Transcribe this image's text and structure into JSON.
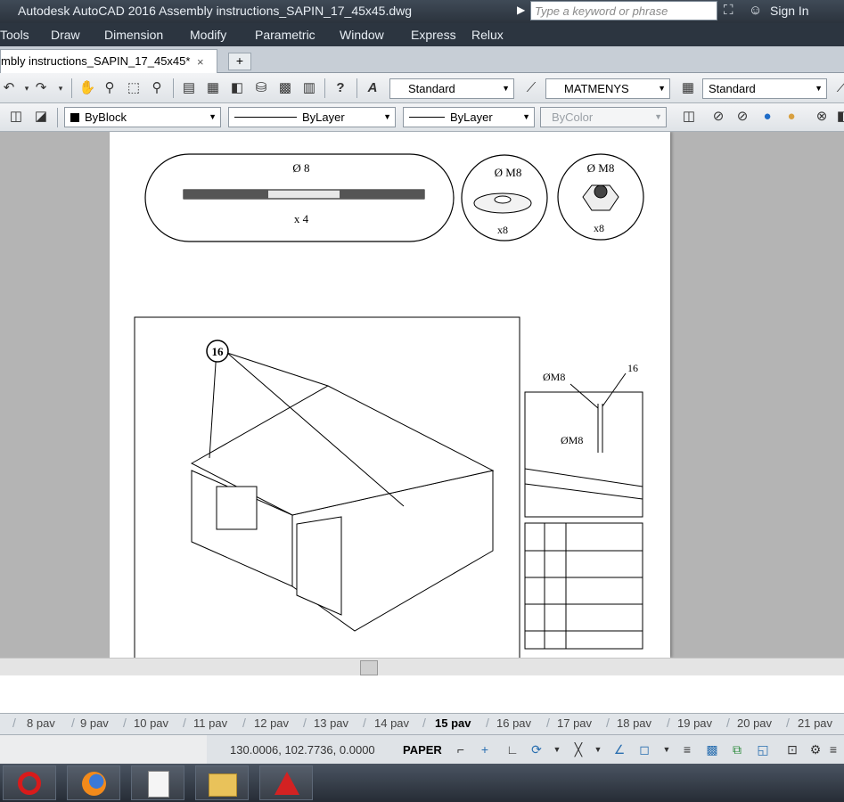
{
  "title_bar": {
    "app_title": "Autodesk AutoCAD 2016    Assembly instructions_SAPIN_17_45x45.dwg",
    "search_placeholder": "Type a keyword or phrase",
    "sign_in": "Sign In"
  },
  "menu": [
    "Tools",
    "Draw",
    "Dimension",
    "Modify",
    "Parametric",
    "Window",
    "Express",
    "Relux"
  ],
  "doc_tab": {
    "label": "mbly instructions_SAPIN_17_45x45*",
    "close": "×",
    "new_tab": "+"
  },
  "toolbar1": {
    "text_style": "Standard",
    "dim_style": "MATMENYS",
    "table_style": "Standard"
  },
  "toolbar2": {
    "color": "ByBlock",
    "linetype": "ByLayer",
    "lineweight": "ByLayer",
    "plotstyle": "ByColor"
  },
  "drawing": {
    "rod_size": "Ø 8",
    "rod_qty": "x 4",
    "washer_size": "Ø M8",
    "washer_qty": "x8",
    "nut_size": "Ø M8",
    "nut_qty": "x8",
    "callout_main": "16",
    "detail_label_m8_a": "ØM8",
    "detail_label_16": "16",
    "detail_label_m8_b": "ØM8"
  },
  "layout_tabs": [
    "8 pav",
    "9 pav",
    "10 pav",
    "11 pav",
    "12 pav",
    "13 pav",
    "14 pav",
    "15 pav",
    "16 pav",
    "17 pav",
    "18 pav",
    "19 pav",
    "20 pav",
    "21 pav"
  ],
  "active_layout": "15 pav",
  "status": {
    "coordinates": "130.0006, 102.7736, 0.0000",
    "space": "PAPER"
  }
}
